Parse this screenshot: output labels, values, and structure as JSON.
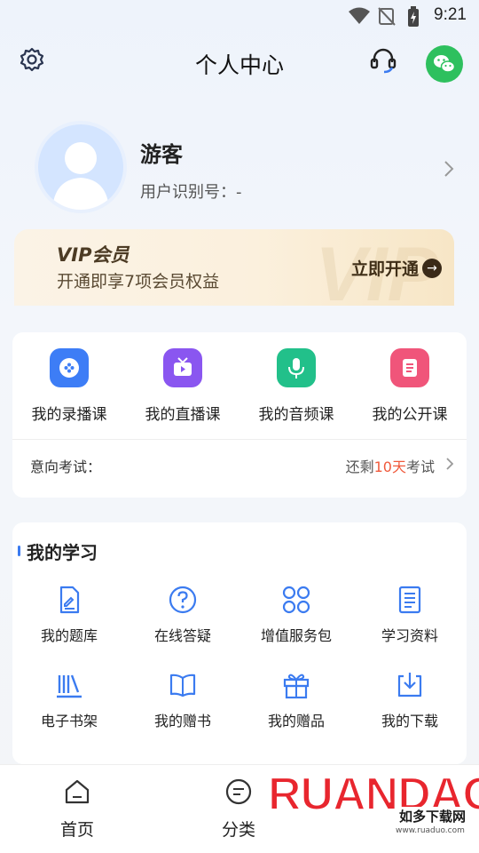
{
  "status_bar": {
    "time": "9:21"
  },
  "header": {
    "title": "个人中心"
  },
  "profile": {
    "name": "游客",
    "user_id": "用户识别号：-"
  },
  "vip": {
    "title": "VIP会员",
    "description": "开通即享7项会员权益",
    "button": "立即开通",
    "watermark": "VIP"
  },
  "courses": [
    {
      "label": "我的录播课",
      "icon": "recorded-course-icon",
      "color": "#3d7df6"
    },
    {
      "label": "我的直播课",
      "icon": "live-course-icon",
      "color": "#8a56f0"
    },
    {
      "label": "我的音频课",
      "icon": "audio-course-icon",
      "color": "#22c08a"
    },
    {
      "label": "我的公开课",
      "icon": "open-course-icon",
      "color": "#f0557a"
    }
  ],
  "exam": {
    "label": "意向考试：",
    "prefix": "还剩",
    "days": "10天",
    "suffix": "考试"
  },
  "study": {
    "title": "我的学习",
    "items": [
      {
        "label": "我的题库",
        "icon": "question-bank-icon"
      },
      {
        "label": "在线答疑",
        "icon": "question-mark-icon"
      },
      {
        "label": "增值服务包",
        "icon": "service-package-icon"
      },
      {
        "label": "学习资料",
        "icon": "document-icon"
      },
      {
        "label": "电子书架",
        "icon": "bookshelf-icon"
      },
      {
        "label": "我的赠书",
        "icon": "open-book-icon"
      },
      {
        "label": "我的赠品",
        "icon": "gift-icon"
      },
      {
        "label": "我的下载",
        "icon": "download-icon"
      }
    ]
  },
  "tabs": [
    {
      "label": "首页",
      "icon": "home-icon"
    },
    {
      "label": "分类",
      "icon": "category-icon"
    }
  ],
  "watermark": {
    "brand": "RUANDAO",
    "sub": "如多下载网",
    "url": "www.ruaduo.com"
  },
  "colors": {
    "accent": "#3b7bf0",
    "highlight": "#f05a3c",
    "icon_blue": "#3b7bf0",
    "wechat": "#2ec05e"
  }
}
